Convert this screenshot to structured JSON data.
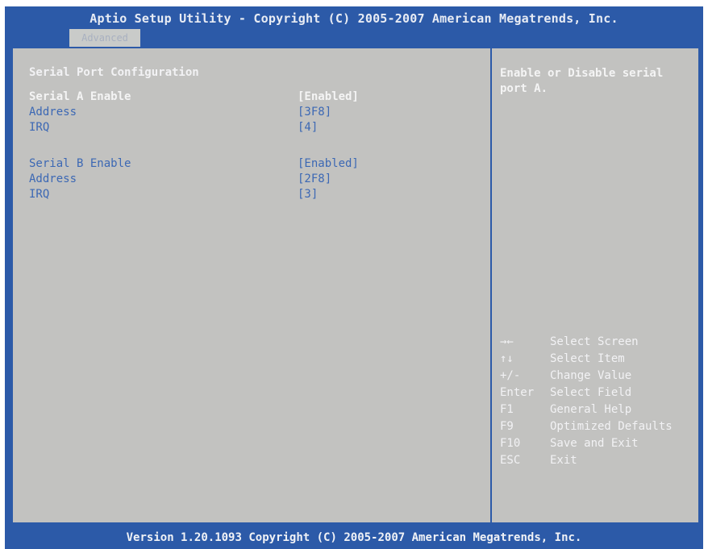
{
  "header": {
    "title": "Aptio Setup Utility - Copyright (C) 2005-2007 American Megatrends, Inc.",
    "tab": "Advanced"
  },
  "main": {
    "section_title": "Serial Port Configuration",
    "serial_a": {
      "enable_label": "Serial A Enable",
      "enable_value": "[Enabled]",
      "address_label": "Address",
      "address_value": "[3F8]",
      "irq_label": "IRQ",
      "irq_value": "[4]"
    },
    "serial_b": {
      "enable_label": "Serial B Enable",
      "enable_value": "[Enabled]",
      "address_label": "Address",
      "address_value": "[2F8]",
      "irq_label": "IRQ",
      "irq_value": "[3]"
    }
  },
  "help": {
    "text": "Enable or Disable serial port A.",
    "keys": [
      {
        "key": "→←",
        "desc": "Select Screen"
      },
      {
        "key": "↑↓",
        "desc": "Select Item"
      },
      {
        "key": "+/-",
        "desc": "Change Value"
      },
      {
        "key": "Enter",
        "desc": "Select Field"
      },
      {
        "key": "F1",
        "desc": "General Help"
      },
      {
        "key": "F9",
        "desc": "Optimized Defaults"
      },
      {
        "key": "F10",
        "desc": "Save and Exit"
      },
      {
        "key": "ESC",
        "desc": "Exit"
      }
    ]
  },
  "footer": {
    "text": "Version 1.20.1093 Copyright (C) 2005-2007 American Megatrends, Inc."
  },
  "colors": {
    "frame_blue": "#2c5aa8",
    "panel_gray": "#c2c2c0",
    "highlight_text": "#f4f4f4",
    "dim_text": "#3c68b4"
  }
}
